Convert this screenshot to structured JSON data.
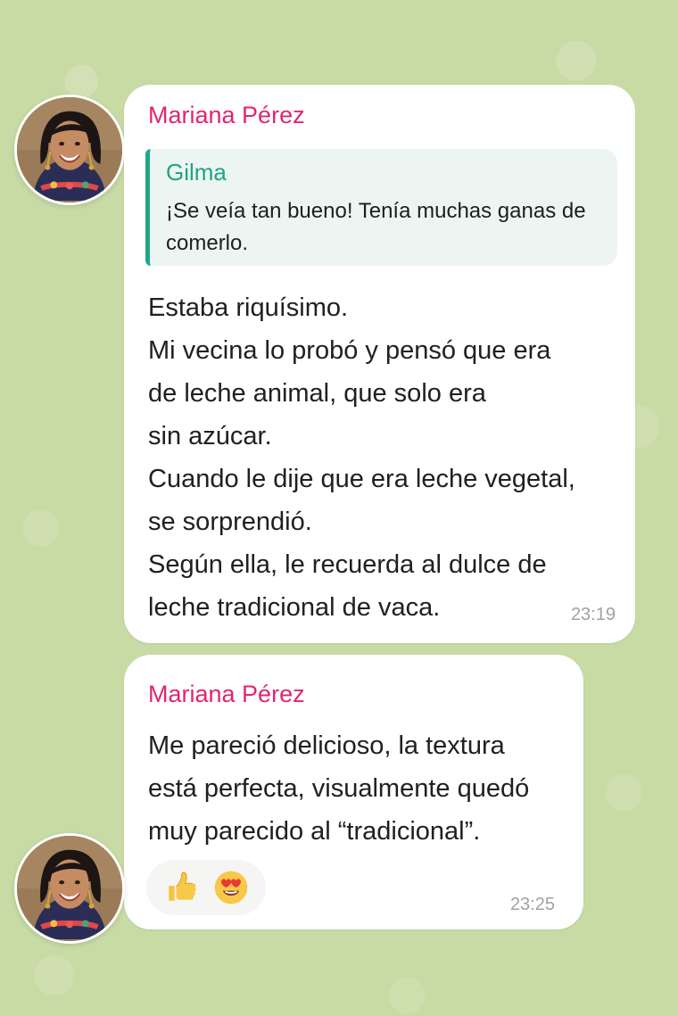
{
  "chat": {
    "messages": [
      {
        "sender": "Mariana Pérez",
        "reply": {
          "name": "Gilma",
          "text": "¡Se veía tan bueno! Tenía muchas ganas de comerlo."
        },
        "lines": [
          "Estaba riquísimo.",
          "Mi vecina lo probó y pensó que era",
          "de leche animal, que solo era",
          "sin azúcar.",
          "Cuando le dije que era leche vegetal,",
          "se sorprendió.",
          "Según ella, le recuerda al dulce de",
          "leche tradicional de vaca."
        ],
        "time": "23:19",
        "avatar_icon": "avatar-photo"
      },
      {
        "sender": "Mariana Pérez",
        "lines": [
          "Me pareció delicioso, la textura",
          "está perfecta, visualmente quedó",
          "muy parecido al “tradicional”."
        ],
        "time": "23:25",
        "avatar_icon": "avatar-photo",
        "reactions": [
          "thumbs-up",
          "heart-eyes"
        ]
      }
    ]
  },
  "colors": {
    "background": "#c8dba5",
    "bubble": "#ffffff",
    "sender": "#e2256f",
    "reply_accent": "#1fa78a",
    "reply_background": "#edf5f2",
    "timestamp": "#a2a2a2"
  }
}
